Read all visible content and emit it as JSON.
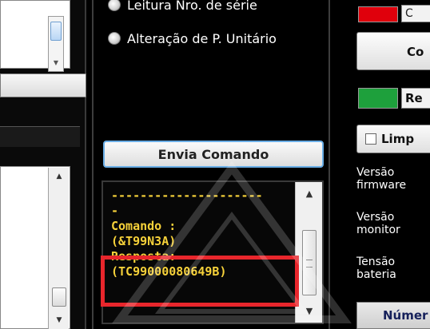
{
  "radio_options": [
    {
      "label": "Leitura Nro. de série"
    },
    {
      "label": "Alteração de P. Unitário"
    }
  ],
  "send_button": {
    "label": "Envia Comando"
  },
  "console": {
    "lines": [
      "---------------------",
      "-",
      "Comando :",
      "(&T99N3A)",
      "Resposta:",
      "(TC99000080649B)"
    ]
  },
  "right_panel": {
    "red_label": "C",
    "top_button_label": "Co",
    "green_label": "Re",
    "clean_label": "Limp",
    "info_labels": [
      {
        "line1": "Versão",
        "line2": "firmware"
      },
      {
        "line1": "Versão",
        "line2": "monitor"
      },
      {
        "line1": "Tensão",
        "line2": "bateria"
      }
    ],
    "bottom_button_label": "Númer"
  },
  "colors": {
    "console_text": "#f7d23a",
    "highlight": "#e8262c",
    "red_swatch": "#e0000c",
    "green_swatch": "#1ea03c"
  }
}
